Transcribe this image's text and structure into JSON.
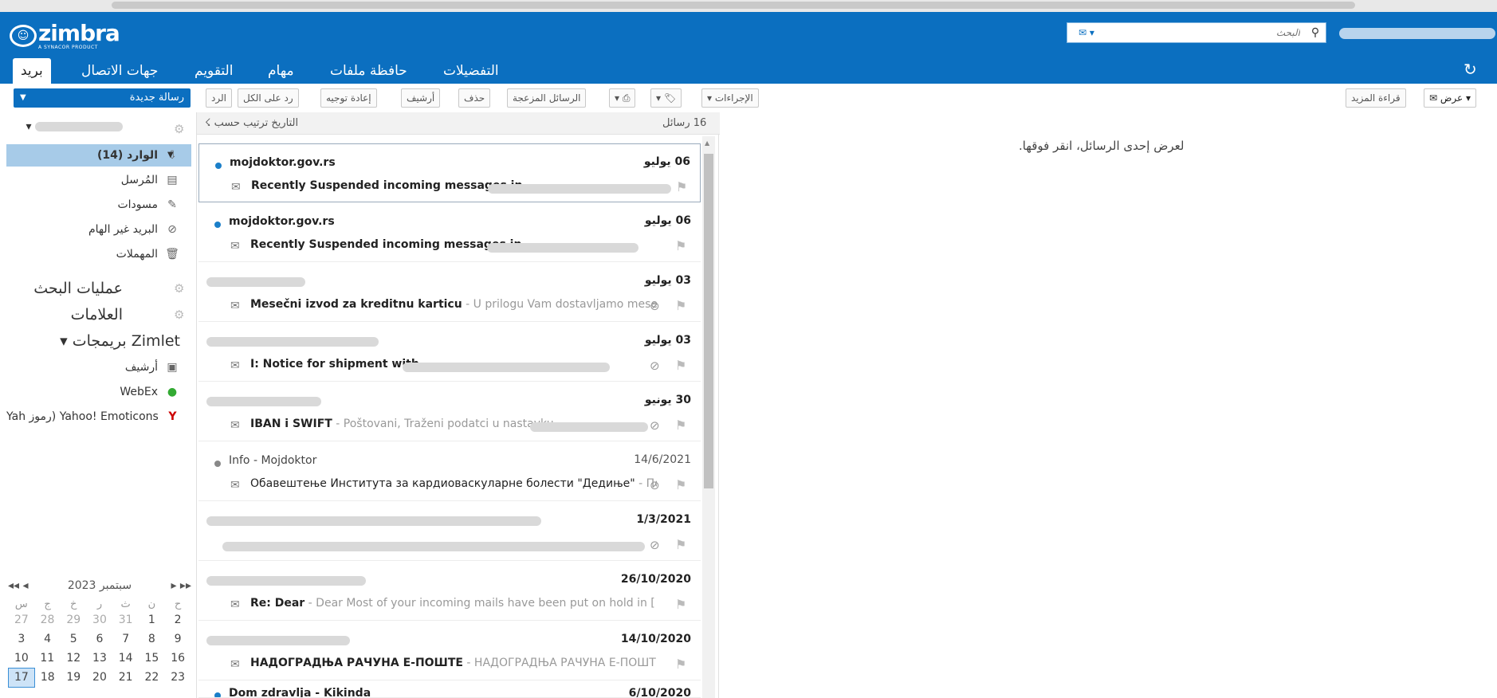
{
  "header": {
    "brand": "zimbra",
    "brand_sub": "A SYNACOR PRODUCT",
    "search_placeholder": "البحث",
    "tabs": [
      {
        "label": "بريد",
        "active": true
      },
      {
        "label": "جهات الاتصال"
      },
      {
        "label": "التقويم"
      },
      {
        "label": "مهام"
      },
      {
        "label": "حافظة ملفات"
      },
      {
        "label": "التفضيلات"
      }
    ]
  },
  "toolbar": {
    "new_message": "رسالة جديدة",
    "reply": "الرد",
    "reply_all": "رد على الكل",
    "forward": "إعادة توجيه",
    "archive": "أرشيف",
    "delete": "حذف",
    "spam": "الرسائل المزعجة",
    "actions": "الإجراءات",
    "read_more": "قراءة المزيد",
    "view": "عرض"
  },
  "sidebar": {
    "folders": [
      {
        "label": "الوارد (14)",
        "icon": "inbox-icon",
        "selected": true
      },
      {
        "label": "المُرسل",
        "icon": "sent-icon"
      },
      {
        "label": "مسودات",
        "icon": "drafts-icon"
      },
      {
        "label": "البريد غير الهام",
        "icon": "junk-icon"
      },
      {
        "label": "المهملات",
        "icon": "trash-icon"
      }
    ],
    "searches": "عمليات البحث",
    "tags": "العلامات",
    "zimlets": "Zimlet بريمجات",
    "zimlet_items": [
      {
        "label": "أرشيف",
        "icon": "archive-icon"
      },
      {
        "label": "WebEx",
        "icon": "webex-icon"
      },
      {
        "label": "Yahoo! Emoticons (رموز Yah",
        "icon": "yahoo-icon"
      }
    ]
  },
  "calendar": {
    "title": "سبتمبر 2023",
    "dow": [
      "س",
      "ج",
      "خ",
      "ر",
      "ث",
      "ن",
      "ح"
    ],
    "weeks": [
      [
        "27",
        "28",
        "29",
        "30",
        "31",
        "1",
        "2"
      ],
      [
        "3",
        "4",
        "5",
        "6",
        "7",
        "8",
        "9"
      ],
      [
        "10",
        "11",
        "12",
        "13",
        "14",
        "15",
        "16"
      ],
      [
        "17",
        "18",
        "19",
        "20",
        "21",
        "22",
        "23"
      ]
    ],
    "today": "17"
  },
  "list": {
    "count": "16 رسائل",
    "sort": "التاريخ ترتيب حسب",
    "messages": [
      {
        "sender": "mojdoktor.gov.rs",
        "date": "06 يوليو",
        "subject": "Recently Suspended incoming messages in",
        "fragment": ""
      },
      {
        "sender": "mojdoktor.gov.rs",
        "date": "06 يوليو",
        "subject": "Recently Suspended incoming messages in",
        "fragment": ""
      },
      {
        "sender": "",
        "date": "03 يوليو",
        "subject": "Mesečni izvod za kreditnu karticu",
        "fragment": " - U prilogu Vam dostavljamo mesečni iz"
      },
      {
        "sender": "",
        "date": "03 يوليو",
        "subject": "I: Notice for shipment with",
        "fragment": ""
      },
      {
        "sender": "",
        "date": "30 يونيو",
        "subject": "IBAN i SWIFT",
        "fragment": " - Poštovani, Traženi podatci u nastavku"
      },
      {
        "sender": "Info - Mojdoktor",
        "date": "14/6/2021",
        "subject": "Обавештење Института за кардиоваскуларне болести \"Дедиње\"",
        "fragment": " - Пошто"
      },
      {
        "sender": "",
        "date": "1/3/2021",
        "subject": "",
        "fragment": ""
      },
      {
        "sender": "",
        "date": "26/10/2020",
        "subject": "Re: Dear",
        "fragment": " - Dear Most of your incoming mails have been put on hold in [ http://m"
      },
      {
        "sender": "",
        "date": "14/10/2020",
        "subject": "НАДОГРАДЊА РАЧУНА Е-ПОШТЕ",
        "fragment": " - НАДОГРАДЊА РАЧУНА Е-ПОШТЕ Пош"
      },
      {
        "sender": "Dom zdravlja - Kikinda",
        "date": "6/10/2020",
        "subject": "",
        "fragment": ""
      }
    ]
  },
  "reading": {
    "hint": "لعرض إحدى الرسائل، انقر فوقها."
  }
}
